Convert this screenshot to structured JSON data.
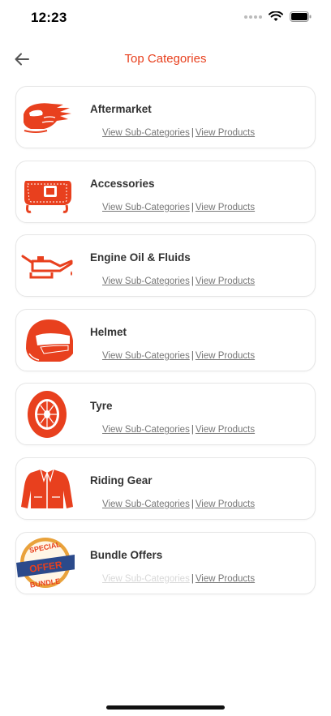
{
  "status": {
    "time": "12:23"
  },
  "header": {
    "title": "Top Categories"
  },
  "links": {
    "sub": "View Sub-Categories",
    "sep": "|",
    "products": "View Products"
  },
  "categories": [
    {
      "title": "Aftermarket",
      "icon": "flame-helmet-icon"
    },
    {
      "title": "Accessories",
      "icon": "saddlebag-icon"
    },
    {
      "title": "Engine Oil & Fluids",
      "icon": "oil-can-icon"
    },
    {
      "title": "Helmet",
      "icon": "helmet-icon"
    },
    {
      "title": "Tyre",
      "icon": "tyre-icon"
    },
    {
      "title": "Riding Gear",
      "icon": "jacket-icon"
    },
    {
      "title": "Bundle Offers",
      "icon": "special-offer-badge-icon"
    }
  ],
  "bundle_badge": {
    "top": "SPECIAL",
    "middle": "OFFER",
    "bottom": "BUNDLE"
  },
  "colors": {
    "accent": "#e8401e",
    "icon": "#e8401e",
    "badge_gold": "#e9a23b",
    "badge_blue": "#2b4a8b"
  }
}
